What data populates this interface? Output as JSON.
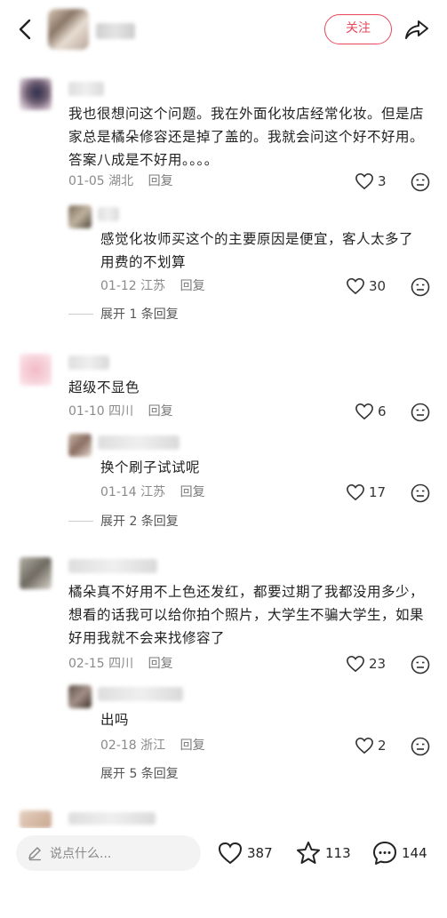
{
  "header": {
    "follow_label": "关注"
  },
  "comments": [
    {
      "text_lines": [
        "我也很想问这个问题。我在外面化妆店经常化妆。但是店",
        "家总是橘朵修容还是掉了盖的。我就会问这个好不好用。",
        "答案八成是不好用。。。。"
      ],
      "date": "01-05",
      "location": "湖北",
      "reply_label": "回复",
      "likes": "3",
      "reply": {
        "text_lines": [
          "感觉化妆师买这个的主要原因是便宜，客人太多了",
          "用费的不划算"
        ],
        "date": "01-12",
        "location": "江苏",
        "reply_label": "回复",
        "likes": "30"
      },
      "expand_label": "展开 1 条回复"
    },
    {
      "text_lines": [
        "超级不显色"
      ],
      "date": "01-10",
      "location": "四川",
      "reply_label": "回复",
      "likes": "6",
      "reply": {
        "text_lines": [
          "换个刷子试试呢"
        ],
        "date": "01-14",
        "location": "江苏",
        "reply_label": "回复",
        "likes": "17"
      },
      "expand_label": "展开 2 条回复"
    },
    {
      "text_lines": [
        "橘朵真不好用不上色还发红，都要过期了我都没用多少，",
        "想看的话我可以给你拍个照片，大学生不骗大学生，如果",
        "好用我就不会来找修容了"
      ],
      "date": "02-15",
      "location": "四川",
      "reply_label": "回复",
      "likes": "23",
      "reply": {
        "text_lines": [
          "出吗"
        ],
        "date": "02-18",
        "location": "浙江",
        "reply_label": "回复",
        "likes": "2"
      },
      "expand_label": "展开 5 条回复"
    }
  ],
  "bottom": {
    "placeholder": "说点什么...",
    "likes": "387",
    "stars": "113",
    "comments": "144"
  },
  "icons": {
    "back": "chevron-left-icon",
    "share": "share-arrow-icon",
    "like": "heart-outline-icon",
    "dislike": "dislike-face-icon",
    "pen": "pen-icon",
    "star": "star-outline-icon",
    "comment": "comment-bubble-icon"
  },
  "colors": {
    "accent": "#e8485a",
    "meta": "#8a8a8a"
  }
}
